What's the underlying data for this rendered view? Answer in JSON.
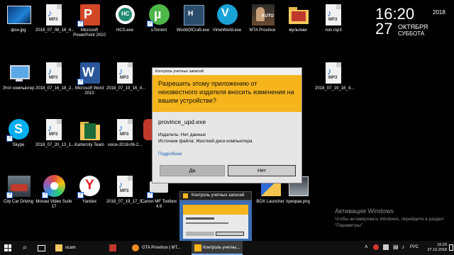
{
  "desktop": {
    "icons": [
      {
        "label": "фон.jpg"
      },
      {
        "label": "2018_07_08_16_4..."
      },
      {
        "label": "Microsoft PowerPoint 2010"
      },
      {
        "label": "HCS.exe"
      },
      {
        "label": "uTorrent"
      },
      {
        "label": "WorldOfCraft.exe"
      },
      {
        "label": "VimeWorld.exe"
      },
      {
        "label": "MTA Province"
      },
      {
        "label": "мультики"
      },
      {
        "label": "non.mp3"
      },
      {
        "label": "Этот компьютер"
      },
      {
        "label": "2018_07_16_18_2..."
      },
      {
        "label": "Microsoft Word 2010"
      },
      {
        "label": "2018_07_19_16_4..."
      },
      {
        "label": "2018_07_19_16_4..."
      },
      {
        "label": "Skype"
      },
      {
        "label": "2018_07_20_13_1..."
      },
      {
        "label": "Kartercity Team"
      },
      {
        "label": "voice-2018-06-2..."
      },
      {
        "label": "City Car Driving"
      },
      {
        "label": "Movavi Video Suite 17"
      },
      {
        "label": "Yandex"
      },
      {
        "label": "2018_07_19_17_0..."
      },
      {
        "label": "Canon MF Toolbox 4.9"
      },
      {
        "label": "BOX Launcher"
      },
      {
        "label": "призрак.png"
      }
    ],
    "mp3_ext": "MP3",
    "icon_art_text": {
      "hcs": "HC",
      "mta_art": "KUTO"
    }
  },
  "clock_widget": {
    "time": "16:20",
    "year": "2018",
    "day": "27",
    "month": "ОКТЯБРЯ",
    "weekday": "СУББОТА"
  },
  "uac": {
    "title": "Контроль учетных записей",
    "question": "Разрешить этому приложению от неизвестного издателя вносить изменения на вашем устройстве?",
    "program": "province_upd.exe",
    "publisher": "Издатель: Нет данных",
    "source": "Источник файла: Жесткий диск компьютера",
    "more_details": "Подробнее",
    "yes_label": "Да",
    "no_label": "Нет",
    "accent": "#f6b51c"
  },
  "preview": {
    "title": "Контроль учетных записей"
  },
  "watermark": {
    "title": "Активация Windows",
    "body": "Чтобы активировать Windows, перейдите в раздел \"Параметры\"."
  },
  "taskbar": {
    "apps": [
      {
        "label": "ocam"
      },
      {
        "label": "GTA Province | MT..."
      },
      {
        "label": "Контроль учетны..."
      }
    ],
    "tray_time": "16:20",
    "tray_date": "27.10.2018",
    "tray_lang": "РУС"
  }
}
